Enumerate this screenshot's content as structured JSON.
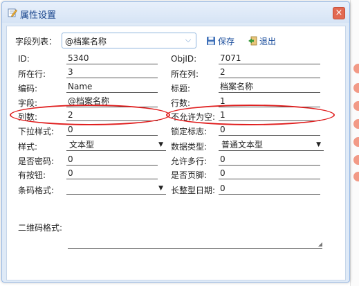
{
  "dialog": {
    "title": "属性设置",
    "close_label": "×"
  },
  "toolbar": {
    "field_list_label": "字段列表：",
    "field_selected": "@档案名称",
    "save_label": "保存",
    "exit_label": "退出"
  },
  "left": {
    "id": {
      "label": "ID:",
      "value": "5340"
    },
    "row": {
      "label": "所在行:",
      "value": "3"
    },
    "code": {
      "label": "编码:",
      "value": "Name"
    },
    "field": {
      "label": "字段:",
      "value": "@档案名称"
    },
    "colspan": {
      "label": "列数:",
      "value": "2"
    },
    "dropstyle": {
      "label": "下拉样式:",
      "value": "0"
    },
    "style": {
      "label": "样式:",
      "value": "文本型"
    },
    "password": {
      "label": "是否密码:",
      "value": "0"
    },
    "hasbutton": {
      "label": "有按钮:",
      "value": "0"
    },
    "barcode": {
      "label": "条码格式:",
      "value": ""
    }
  },
  "right": {
    "objid": {
      "label": "ObjID:",
      "value": "7071"
    },
    "col": {
      "label": "所在列:",
      "value": "2"
    },
    "title": {
      "label": "标题:",
      "value": "档案名称"
    },
    "rows": {
      "label": "行数:",
      "value": "1"
    },
    "notnull": {
      "label": "不允许为空:",
      "value": "1"
    },
    "lockflag": {
      "label": "锁定标志:",
      "value": "0"
    },
    "datatype": {
      "label": "数据类型:",
      "value": "普通文本型"
    },
    "multiline": {
      "label": "允许多行:",
      "value": "0"
    },
    "footer": {
      "label": "是否页脚:",
      "value": "0"
    },
    "longdate": {
      "label": "长整型日期:",
      "value": "0"
    }
  },
  "qrcode": {
    "label": "二维码格式:",
    "value": ""
  },
  "colors": {
    "accent": "#15428b",
    "annotation": "#e02020",
    "close": "#e26a52"
  }
}
